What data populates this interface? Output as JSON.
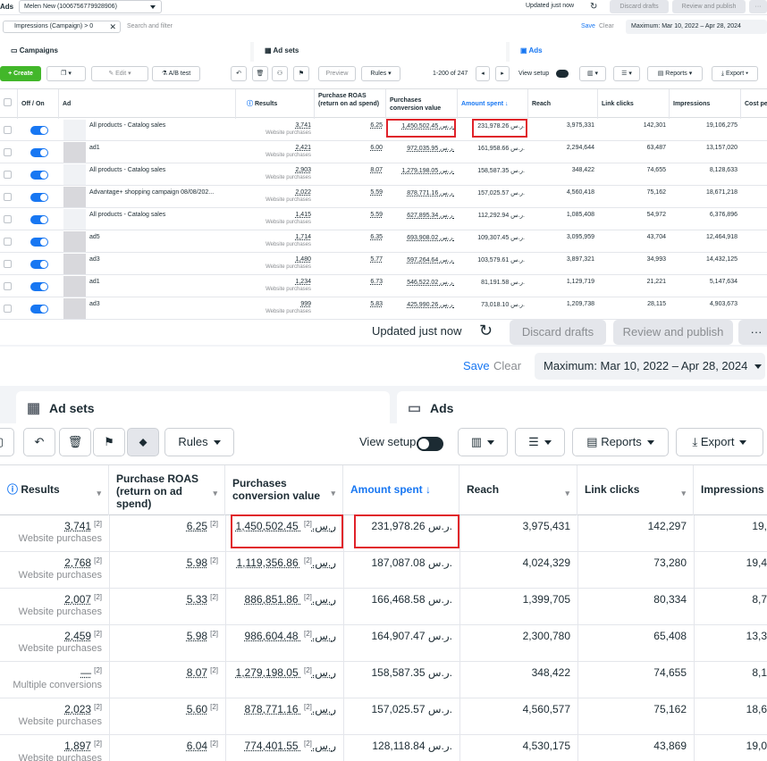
{
  "top": {
    "account_label": "Ads",
    "account_name": "Melen New (1006756779928906)",
    "updated": "Updated just now",
    "discard": "Discard drafts",
    "review": "Review and publish",
    "filter_chip": "Impressions (Campaign) > 0",
    "search_placeholder": "Search and filter",
    "save": "Save",
    "clear": "Clear",
    "date_range": "Maximum: Mar 10, 2022 – Apr 28, 2024",
    "tabs": {
      "campaigns": "Campaigns",
      "adsets": "Ad sets",
      "ads": "Ads"
    },
    "toolbar": {
      "create": "Create",
      "edit": "Edit",
      "ab_test": "A/B test",
      "preview": "Preview",
      "rules": "Rules",
      "pagination": "1-200 of 247",
      "view_setup": "View setup",
      "reports": "Reports",
      "export": "Export"
    },
    "headers": {
      "off_on": "Off / On",
      "ad": "Ad",
      "results": "Results",
      "roas": "Purchase ROAS (return on ad spend)",
      "pcv": "Purchases conversion value",
      "amount": "Amount spent ↓",
      "reach": "Reach",
      "link_clicks": "Link clicks",
      "impressions": "Impressions",
      "cost": "Cost pe"
    },
    "rows": [
      {
        "ad": "All products - Catalog sales",
        "results": "3,741",
        "sub": "Website purchases",
        "roas": "6.25",
        "pcv": "1,450,502.45 ر.س.",
        "amount": "231,978.26 ر.س.",
        "reach": "3,975,331",
        "clicks": "142,301",
        "impr": "19,106,275"
      },
      {
        "ad": "ad1",
        "results": "2,421",
        "sub": "Website purchases",
        "roas": "6.00",
        "pcv": "972,035.95 ر.س.",
        "amount": "161,958.66 ر.س.",
        "reach": "2,294,644",
        "clicks": "63,487",
        "impr": "13,157,020"
      },
      {
        "ad": "All products - Catalog sales",
        "results": "2,903",
        "sub": "Website purchases",
        "roas": "8.07",
        "pcv": "1,279,198.05 ر.س.",
        "amount": "158,587.35 ر.س.",
        "reach": "348,422",
        "clicks": "74,655",
        "impr": "8,128,633"
      },
      {
        "ad": "Advantage+ shopping campaign 08/08/202...",
        "results": "2,022",
        "sub": "Website purchases",
        "roas": "5.59",
        "pcv": "878,771.16 ر.س.",
        "amount": "157,025.57 ر.س.",
        "reach": "4,560,418",
        "clicks": "75,162",
        "impr": "18,671,218"
      },
      {
        "ad": "All products - Catalog sales",
        "results": "1,415",
        "sub": "Website purchases",
        "roas": "5.59",
        "pcv": "627,895.34 ر.س.",
        "amount": "112,292.94 ر.س.",
        "reach": "1,085,408",
        "clicks": "54,972",
        "impr": "6,376,896"
      },
      {
        "ad": "ad5",
        "results": "1,714",
        "sub": "Website purchases",
        "roas": "6.35",
        "pcv": "693,908.02 ر.س.",
        "amount": "109,307.45 ر.س.",
        "reach": "3,095,959",
        "clicks": "43,704",
        "impr": "12,464,918"
      },
      {
        "ad": "ad3",
        "results": "1,480",
        "sub": "Website purchases",
        "roas": "5.77",
        "pcv": "597,264.64 ر.س.",
        "amount": "103,579.61 ر.س.",
        "reach": "3,897,321",
        "clicks": "34,993",
        "impr": "14,432,125"
      },
      {
        "ad": "ad1",
        "results": "1,234",
        "sub": "Website purchases",
        "roas": "6.73",
        "pcv": "546,522.02 ر.س.",
        "amount": "81,191.58 ر.س.",
        "reach": "1,129,719",
        "clicks": "21,221",
        "impr": "5,147,634"
      },
      {
        "ad": "ad3",
        "results": "999",
        "sub": "Website purchases",
        "roas": "5.83",
        "pcv": "425,990.26 ر.س.",
        "amount": "73,018.10 ر.س.",
        "reach": "1,209,738",
        "clicks": "28,115",
        "impr": "4,903,673"
      }
    ]
  },
  "bottom": {
    "updated": "Updated just now",
    "discard": "Discard drafts",
    "review": "Review and publish",
    "more": "···",
    "save": "Save",
    "clear": "Clear",
    "date_range": "Maximum: Mar 10, 2022 – Apr 28, 2024",
    "tabs": {
      "adsets": "Ad sets",
      "ads": "Ads"
    },
    "toolbar": {
      "rules": "Rules",
      "view_setup": "View setup",
      "reports": "Reports",
      "export": "Export"
    },
    "headers": {
      "results": "Results",
      "roas": "Purchase ROAS (return on ad spend)",
      "pcv": "Purchases conversion value",
      "amount": "Amount spent ↓",
      "reach": "Reach",
      "link_clicks": "Link clicks",
      "impressions": "Impressions"
    },
    "sup": "[2]",
    "rows": [
      {
        "results": "3,741",
        "sub": "Website purchases",
        "roas": "6.25",
        "pcv": "1,450,502.45 ر.س.",
        "amount": "231,978.26 ر.س.",
        "reach": "3,975,431",
        "clicks": "142,297",
        "impr": "19,"
      },
      {
        "results": "2,768",
        "sub": "Website purchases",
        "roas": "5.98",
        "pcv": "1,119,356.86 ر.س.",
        "amount": "187,087.08 ر.س.",
        "reach": "4,024,329",
        "clicks": "73,280",
        "impr": "19,4"
      },
      {
        "results": "2,007",
        "sub": "Website purchases",
        "roas": "5.33",
        "pcv": "886,851.86 ر.س.",
        "amount": "166,468.58 ر.س.",
        "reach": "1,399,705",
        "clicks": "80,334",
        "impr": "8,7"
      },
      {
        "results": "2,459",
        "sub": "Website purchases",
        "roas": "5.98",
        "pcv": "986,604.48 ر.س.",
        "amount": "164,907.47 ر.س.",
        "reach": "2,300,780",
        "clicks": "65,408",
        "impr": "13,3"
      },
      {
        "results": "—",
        "sub": "Multiple conversions",
        "roas": "8.07",
        "pcv": "1,279,198.05 ر.س.",
        "amount": "158,587.35 ر.س.",
        "reach": "348,422",
        "clicks": "74,655",
        "impr": "8,1"
      },
      {
        "results": "2,023",
        "sub": "Website purchases",
        "roas": "5.60",
        "pcv": "878,771.16 ر.س.",
        "amount": "157,025.57 ر.س.",
        "reach": "4,560,577",
        "clicks": "75,162",
        "impr": "18,6"
      },
      {
        "results": "1,897",
        "sub": "Website purchases",
        "roas": "6.04",
        "pcv": "774,401.55 ر.س.",
        "amount": "128,118.84 ر.س.",
        "reach": "4,530,175",
        "clicks": "43,869",
        "impr": "19,0"
      }
    ]
  }
}
